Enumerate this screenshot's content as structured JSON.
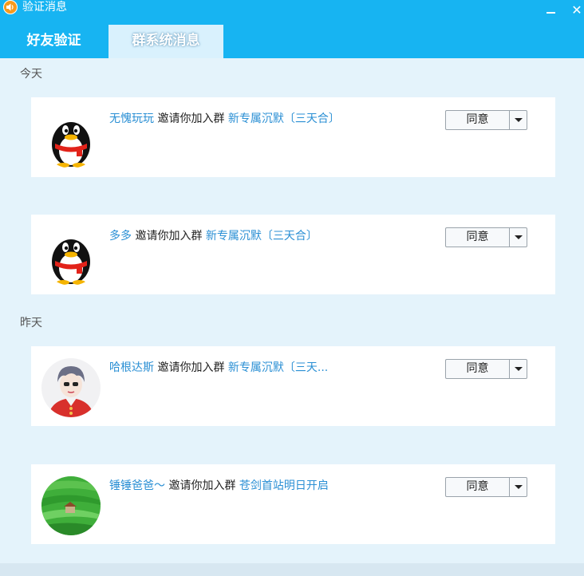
{
  "window": {
    "title": "验证消息",
    "minimize_label": "",
    "close_label": "✕"
  },
  "tabs": [
    {
      "label": "好友验证",
      "active": false
    },
    {
      "label": "群系统消息",
      "active": true
    }
  ],
  "colors": {
    "titlebar": "#17b4f2",
    "background": "#e4f3fb",
    "link": "#2a8fd4"
  },
  "groups": [
    {
      "day": "今天",
      "items": [
        {
          "user": "无愧玩玩",
          "text": " 邀请你加入群 ",
          "group": "新专属沉默〔三天合〕",
          "button": "同意",
          "avatar": "qq-penguin-icon"
        },
        {
          "user": "多多",
          "text": " 邀请你加入群 ",
          "group": "新专属沉默〔三天合〕",
          "button": "同意",
          "avatar": "qq-penguin-icon"
        }
      ]
    },
    {
      "day": "昨天",
      "items": [
        {
          "user": "哈根达斯",
          "text": " 邀请你加入群 ",
          "group": "新专属沉默〔三天...",
          "button": "同意",
          "avatar": "anime-avatar"
        },
        {
          "user": "锤锤爸爸～",
          "text": " 邀请你加入群 ",
          "group": "苍剑首站明日开启",
          "button": "同意",
          "avatar": "landscape-avatar"
        }
      ]
    }
  ]
}
